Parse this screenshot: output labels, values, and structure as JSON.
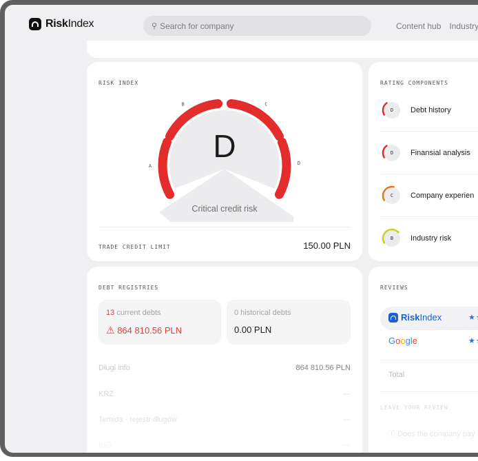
{
  "header": {
    "logo_bold": "Risk",
    "logo_light": "Index",
    "search_placeholder": "Search for company",
    "nav": [
      "Content hub",
      "Industry"
    ]
  },
  "risk_index": {
    "title": "RISK INDEX",
    "grade": "D",
    "status": "Critical credit risk",
    "scale_labels": [
      "A",
      "B",
      "C",
      "D"
    ],
    "trade_credit_limit_label": "TRADE CREDIT LIMIT",
    "trade_credit_limit_value": "150.00 PLN",
    "colors": {
      "gauge_active": "#e32c2c",
      "gauge_track": "#ececee"
    }
  },
  "rating_components": {
    "title": "RATING COMPONENTS",
    "items": [
      {
        "grade": "D",
        "name": "Debt history",
        "color": "#e32c2c",
        "level": 0.35
      },
      {
        "grade": "D",
        "name": "Finansial analysis",
        "color": "#e32c2c",
        "level": 0.35
      },
      {
        "grade": "C",
        "name": "Company experien",
        "color": "#e07a1c",
        "level": 0.55
      },
      {
        "grade": "B",
        "name": "Industry risk",
        "color": "#c9d21f",
        "level": 0.7
      }
    ]
  },
  "debt_registries": {
    "title": "DEBT REGISTRIES",
    "current": {
      "count": "13",
      "label": "current debts",
      "amount": "864 810.56 PLN"
    },
    "historical": {
      "label": "0 historical debts",
      "amount": "0.00 PLN"
    },
    "rows": [
      {
        "name": "Długi info",
        "value": "864 810.56 PLN"
      },
      {
        "name": "KRZ",
        "value": "—"
      },
      {
        "name": "Temida - rejestr długów",
        "value": "—"
      },
      {
        "name": "BIG",
        "value": "—"
      }
    ]
  },
  "reviews": {
    "title": "REVIEWS",
    "sources": [
      {
        "name_bold": "Risk",
        "name_light": "Index",
        "stars": "★★"
      },
      {
        "name": "Google",
        "stars": "★★"
      }
    ],
    "total_label": "Total",
    "leave_label": "LEAVE YOUR REVIEW",
    "question": "Does the company pay"
  }
}
